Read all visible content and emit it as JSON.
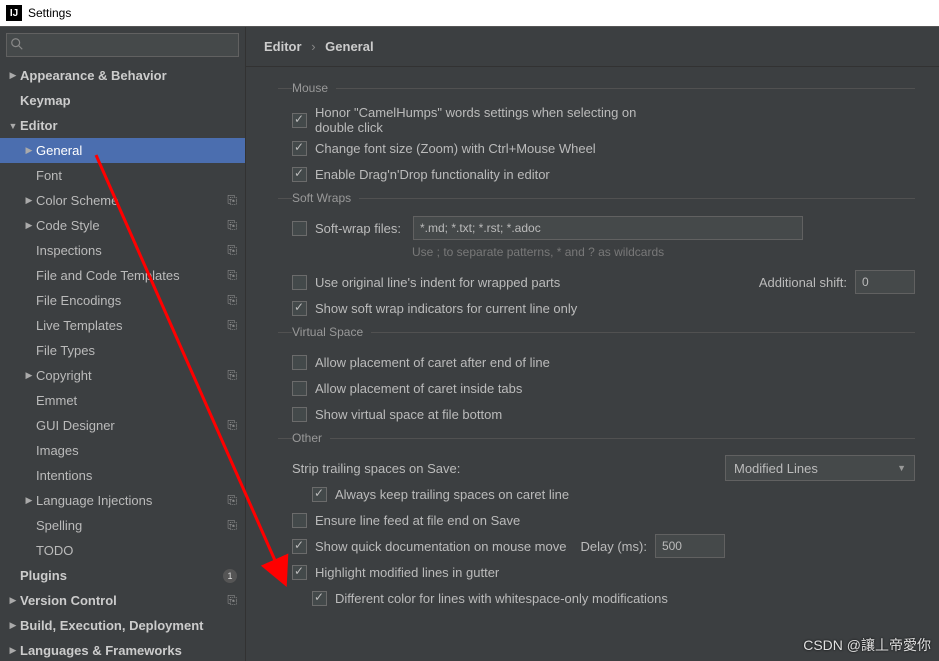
{
  "window": {
    "title": "Settings"
  },
  "search": {
    "placeholder": ""
  },
  "sidebar": {
    "items": [
      {
        "label": "Appearance & Behavior",
        "kind": "expand",
        "depth": 0,
        "bold": true,
        "arrow": "▶"
      },
      {
        "label": "Keymap",
        "kind": "leaf",
        "depth": 0,
        "bold": true
      },
      {
        "label": "Editor",
        "kind": "expand",
        "depth": 0,
        "bold": true,
        "arrow": "▼"
      },
      {
        "label": "General",
        "kind": "expand",
        "depth": 1,
        "arrow": "▶",
        "selected": true
      },
      {
        "label": "Font",
        "kind": "leaf",
        "depth": 1
      },
      {
        "label": "Color Scheme",
        "kind": "expand",
        "depth": 1,
        "arrow": "▶",
        "badge": "⎘"
      },
      {
        "label": "Code Style",
        "kind": "expand",
        "depth": 1,
        "arrow": "▶",
        "badge": "⎘"
      },
      {
        "label": "Inspections",
        "kind": "leaf",
        "depth": 1,
        "badge": "⎘"
      },
      {
        "label": "File and Code Templates",
        "kind": "leaf",
        "depth": 1,
        "badge": "⎘"
      },
      {
        "label": "File Encodings",
        "kind": "leaf",
        "depth": 1,
        "badge": "⎘"
      },
      {
        "label": "Live Templates",
        "kind": "leaf",
        "depth": 1,
        "badge": "⎘"
      },
      {
        "label": "File Types",
        "kind": "leaf",
        "depth": 1
      },
      {
        "label": "Copyright",
        "kind": "expand",
        "depth": 1,
        "arrow": "▶",
        "badge": "⎘"
      },
      {
        "label": "Emmet",
        "kind": "leaf",
        "depth": 1
      },
      {
        "label": "GUI Designer",
        "kind": "leaf",
        "depth": 1,
        "badge": "⎘"
      },
      {
        "label": "Images",
        "kind": "leaf",
        "depth": 1
      },
      {
        "label": "Intentions",
        "kind": "leaf",
        "depth": 1
      },
      {
        "label": "Language Injections",
        "kind": "expand",
        "depth": 1,
        "arrow": "▶",
        "badge": "⎘"
      },
      {
        "label": "Spelling",
        "kind": "leaf",
        "depth": 1,
        "badge": "⎘"
      },
      {
        "label": "TODO",
        "kind": "leaf",
        "depth": 1
      },
      {
        "label": "Plugins",
        "kind": "leaf",
        "depth": 0,
        "bold": true,
        "notif": "1"
      },
      {
        "label": "Version Control",
        "kind": "expand",
        "depth": 0,
        "bold": true,
        "arrow": "▶",
        "badge": "⎘"
      },
      {
        "label": "Build, Execution, Deployment",
        "kind": "expand",
        "depth": 0,
        "bold": true,
        "arrow": "▶"
      },
      {
        "label": "Languages & Frameworks",
        "kind": "expand",
        "depth": 0,
        "bold": true,
        "arrow": "▶"
      }
    ]
  },
  "breadcrumb": {
    "a": "Editor",
    "b": "General"
  },
  "sections": {
    "mouse": {
      "legend": "Mouse",
      "honor": "Honor \"CamelHumps\" words settings when selecting on double click",
      "zoom": "Change font size (Zoom) with Ctrl+Mouse Wheel",
      "dnd": "Enable Drag'n'Drop functionality in editor"
    },
    "wraps": {
      "legend": "Soft Wraps",
      "soft_label": "Soft-wrap files:",
      "soft_value": "*.md; *.txt; *.rst; *.adoc",
      "helper": "Use ; to separate patterns, * and ? as wildcards",
      "orig": "Use original line's indent for wrapped parts",
      "add_shift_label": "Additional shift:",
      "add_shift_value": "0",
      "show_ind": "Show soft wrap indicators for current line only"
    },
    "vspace": {
      "legend": "Virtual Space",
      "eol": "Allow placement of caret after end of line",
      "tabs": "Allow placement of caret inside tabs",
      "bottom": "Show virtual space at file bottom"
    },
    "other": {
      "legend": "Other",
      "strip_label": "Strip trailing spaces on Save:",
      "strip_value": "Modified Lines",
      "keep": "Always keep trailing spaces on caret line",
      "ensure": "Ensure line feed at file end on Save",
      "quick": "Show quick documentation on mouse move",
      "delay_label": "Delay (ms):",
      "delay_value": "500",
      "highlight": "Highlight modified lines in gutter",
      "diffcolor": "Different color for lines with whitespace-only modifications"
    }
  },
  "watermark": "CSDN @讓丄帝愛你"
}
